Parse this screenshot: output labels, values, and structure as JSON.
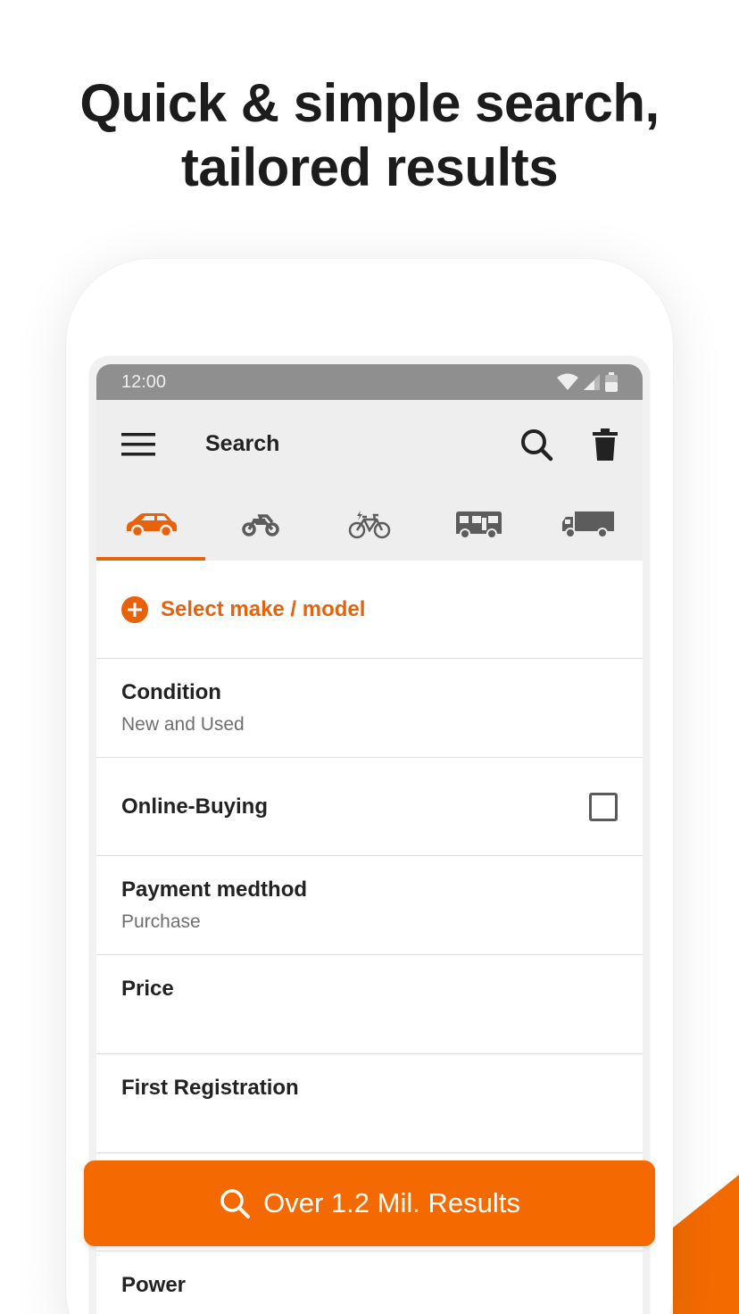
{
  "headline": {
    "line1": "Quick & simple search,",
    "line2": "tailored results"
  },
  "statusbar": {
    "time": "12:00"
  },
  "appbar": {
    "title": "Search",
    "icons": [
      "menu-icon",
      "search-icon",
      "trash-icon"
    ]
  },
  "tabs": [
    {
      "icon": "car-icon",
      "active": true
    },
    {
      "icon": "motorbike-icon",
      "active": false
    },
    {
      "icon": "ebike-icon",
      "active": false
    },
    {
      "icon": "motorhome-icon",
      "active": false
    },
    {
      "icon": "truck-icon",
      "active": false
    }
  ],
  "form": {
    "select_make_model": "Select make / model",
    "condition": {
      "label": "Condition",
      "value": "New and Used"
    },
    "online_buying": {
      "label": "Online-Buying",
      "checked": false
    },
    "payment": {
      "label": "Payment medthod",
      "value": "Purchase"
    },
    "price": {
      "label": "Price"
    },
    "first_registration": {
      "label": "First Registration"
    },
    "power": {
      "label": "Power"
    }
  },
  "results_button": {
    "label": "Over 1.2 Mil. Results"
  },
  "colors": {
    "accent": "#e8620b",
    "button": "#f56a00",
    "statusbar": "#8f8f8f",
    "appbar": "#eeeeee"
  }
}
